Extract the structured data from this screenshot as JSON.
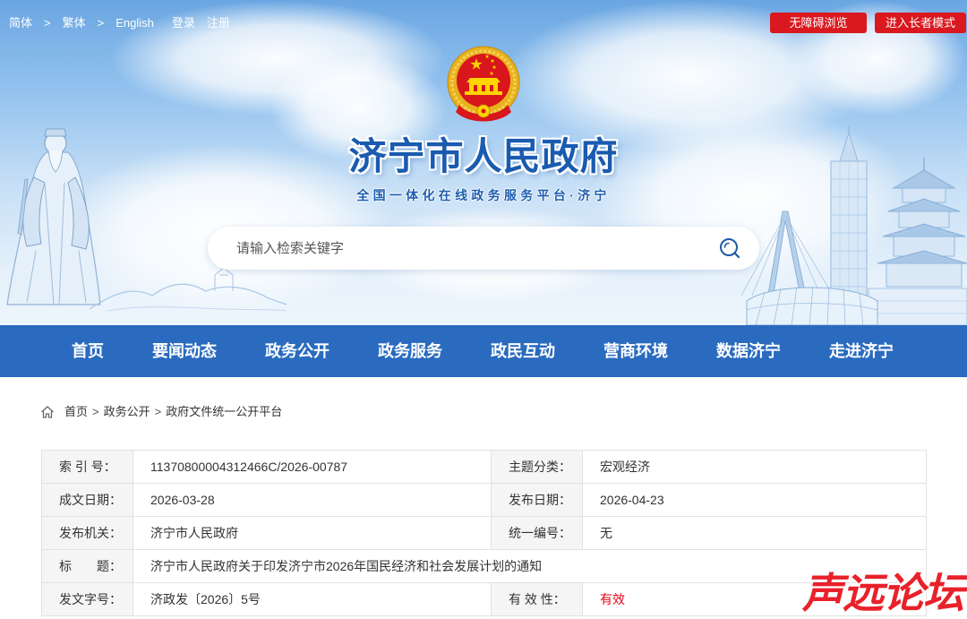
{
  "top_bar": {
    "lang_simplified": "简体",
    "separator": ">",
    "lang_traditional": "繁体",
    "lang_english": "English",
    "login": "登录",
    "register": "注册",
    "accessibility_button": "无障碍浏览",
    "elder_mode_button": "进入长者模式"
  },
  "header": {
    "emblem_icon": "national-emblem-icon",
    "site_title": "济宁市人民政府",
    "site_subtitle": "全国一体化在线政务服务平台·济宁",
    "search": {
      "placeholder": "请输入检索关键字",
      "icon": "search-icon"
    }
  },
  "nav": {
    "items": [
      "首页",
      "要闻动态",
      "政务公开",
      "政务服务",
      "政民互动",
      "营商环境",
      "数据济宁",
      "走进济宁"
    ]
  },
  "breadcrumb": {
    "icon": "home-icon",
    "separator": ">",
    "items": [
      "首页",
      "政务公开",
      "政府文件统一公开平台"
    ]
  },
  "document_info": {
    "index_no": {
      "label": "索 引 号：",
      "value": "11370800004312466C/2026-00787"
    },
    "topic": {
      "label": "主题分类：",
      "value": "宏观经济"
    },
    "written_date": {
      "label": "成文日期：",
      "value": "2026-03-28"
    },
    "publish_date": {
      "label": "发布日期：",
      "value": "2026-04-23"
    },
    "issuer": {
      "label": "发布机关：",
      "value": "济宁市人民政府"
    },
    "unified_no": {
      "label": "统一编号：",
      "value": "无"
    },
    "title": {
      "label": "标　　题：",
      "value": "济宁市人民政府关于印发济宁市2026年国民经济和社会发展计划的通知"
    },
    "doc_no": {
      "label": "发文字号：",
      "value": "济政发〔2026〕5号"
    },
    "validity": {
      "label": "有 效 性：",
      "value": "有效"
    }
  },
  "watermark": {
    "text": "声远论坛"
  },
  "theme": {
    "nav_background": "#2a6bbf",
    "button_red": "#d9181f",
    "title_blue": "#1a5bb0",
    "validity_red": "#e60012"
  }
}
